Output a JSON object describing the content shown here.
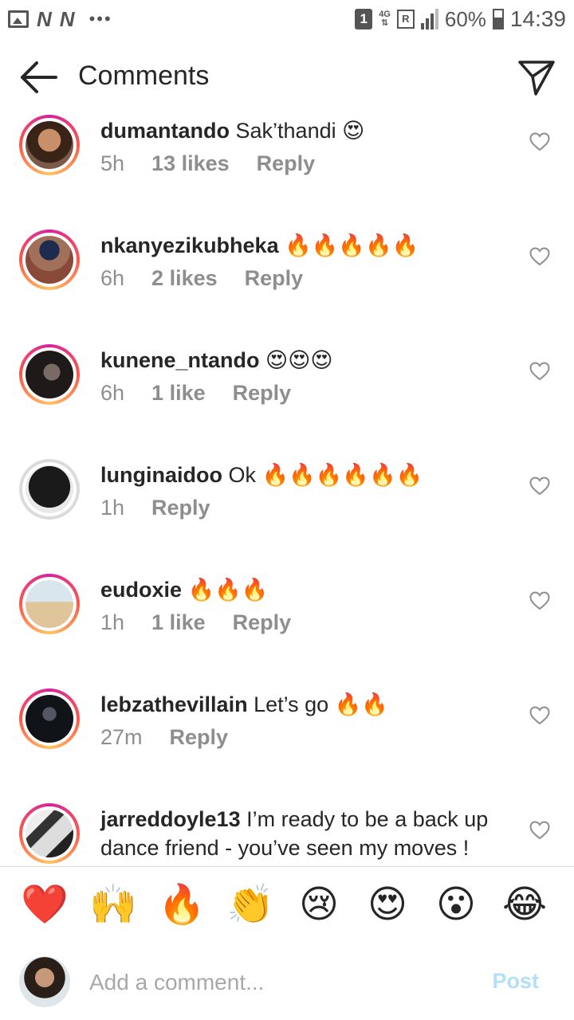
{
  "status_bar": {
    "sim": "1",
    "network": "4G",
    "roaming": "R",
    "battery": "60%",
    "time": "14:39",
    "notification_letters": [
      "N",
      "N"
    ]
  },
  "header": {
    "title": "Comments"
  },
  "comments": [
    {
      "username": "dumantando",
      "text": "Sak’thandi 😍",
      "time": "5h",
      "likes": "13 likes",
      "reply": "Reply",
      "avatar_ring": "story"
    },
    {
      "username": "nkanyezikubheka",
      "text": "🔥🔥🔥🔥🔥",
      "time": "6h",
      "likes": "2 likes",
      "reply": "Reply",
      "avatar_ring": "story"
    },
    {
      "username": "kunene_ntando",
      "text": "😍😍😍",
      "time": "6h",
      "likes": "1 like",
      "reply": "Reply",
      "avatar_ring": "story"
    },
    {
      "username": "lunginaidoo",
      "text": "Ok 🔥🔥🔥🔥🔥🔥",
      "time": "1h",
      "likes": "",
      "reply": "Reply",
      "avatar_ring": "none"
    },
    {
      "username": "eudoxie",
      "text": "🔥🔥🔥",
      "time": "1h",
      "likes": "1 like",
      "reply": "Reply",
      "avatar_ring": "story"
    },
    {
      "username": "lebzathevillain",
      "text": "Let’s go 🔥🔥",
      "time": "27m",
      "likes": "",
      "reply": "Reply",
      "avatar_ring": "story"
    },
    {
      "username": "jarreddoyle13",
      "text": "I’m ready to be a back up dance friend - you’ve seen my moves !",
      "time": "",
      "likes": "",
      "reply": "",
      "avatar_ring": "story"
    }
  ],
  "emoji_bar": [
    "❤️",
    "🙌",
    "🔥",
    "👏",
    "😢",
    "😍",
    "😮",
    "😂"
  ],
  "input": {
    "placeholder": "Add a comment...",
    "post_label": "Post"
  },
  "colors": {
    "accent_disabled": "#b2dffc",
    "secondary_text": "#8e8e8e",
    "story_ring": "#d6249f"
  },
  "icons": {
    "back": "arrow-left-icon",
    "send": "send-icon",
    "like": "heart-outline-icon"
  }
}
